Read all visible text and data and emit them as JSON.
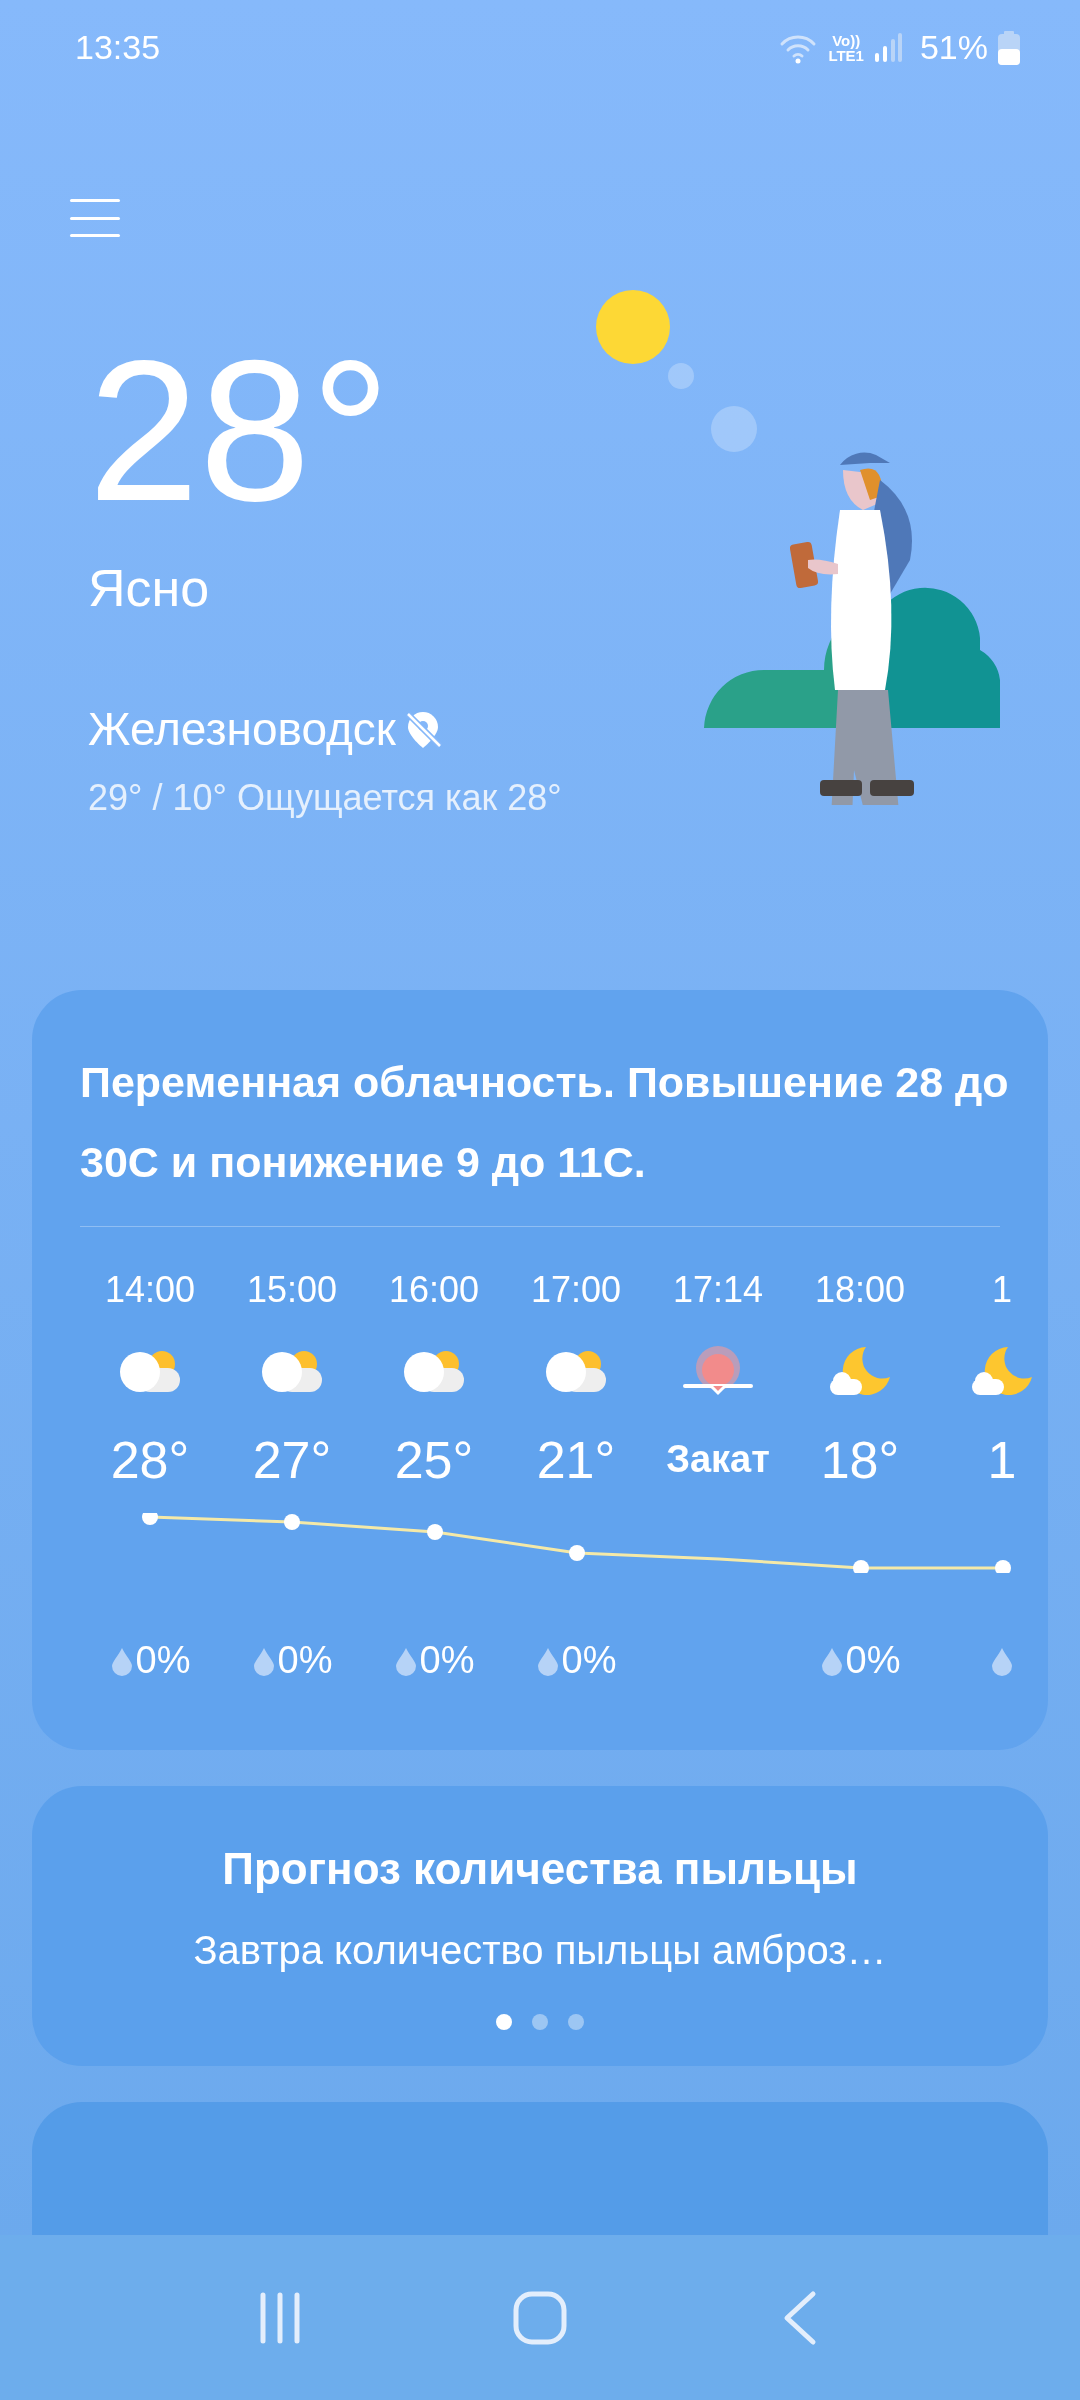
{
  "status_bar": {
    "time": "13:35",
    "volte": "Vo))",
    "network": "LTE1",
    "battery": "51%"
  },
  "current": {
    "temperature": "28°",
    "condition": "Ясно",
    "location": "Железноводск",
    "details": "29° / 10° Ощущается как 28°"
  },
  "hourly_card": {
    "summary": "Переменная облачность. Повышение 28 до 30С и понижение 9 до 11С.",
    "hours": [
      {
        "time": "14:00",
        "kind": "partly_cloudy",
        "value": "28°",
        "precipitation": "0%"
      },
      {
        "time": "15:00",
        "kind": "partly_cloudy",
        "value": "27°",
        "precipitation": "0%"
      },
      {
        "time": "16:00",
        "kind": "partly_cloudy",
        "value": "25°",
        "precipitation": "0%"
      },
      {
        "time": "17:00",
        "kind": "partly_cloudy",
        "value": "21°",
        "precipitation": "0%"
      },
      {
        "time": "17:14",
        "kind": "sunset",
        "value": "Закат"
      },
      {
        "time": "18:00",
        "kind": "moon_cloud",
        "value": "18°",
        "precipitation": "0%"
      },
      {
        "time": "1",
        "kind": "moon_cloud",
        "value": "1"
      }
    ]
  },
  "pollen_card": {
    "title": "Прогноз количества пыльцы",
    "text": "Завтра количество пыльцы амброз…",
    "pages": [
      {
        "selected": true
      },
      {
        "selected": false
      },
      {
        "selected": false
      }
    ]
  }
}
